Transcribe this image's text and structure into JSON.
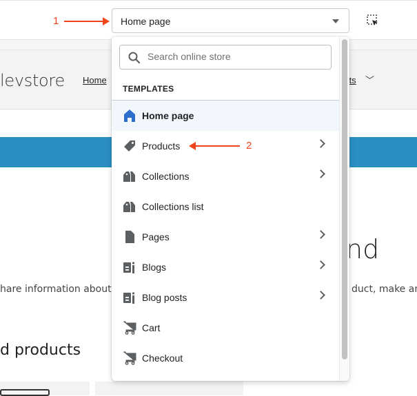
{
  "toolbar": {
    "template_select_value": "Home page",
    "caret_icon": "caret-down-icon",
    "inspect_icon": "select-element-icon"
  },
  "annotations": {
    "one": "1",
    "two": "2",
    "color": "#f0441c"
  },
  "storefront": {
    "store_name": "levstore",
    "nav_home": "Home",
    "nav_products": "cts",
    "banner_color": "#2a8fc1",
    "hero_text": "nd",
    "desc_left": "hare information about",
    "desc_right": "duct, make an",
    "featured": "d products"
  },
  "dropdown": {
    "search_placeholder": "Search online store",
    "section_label": "TEMPLATES",
    "items": [
      {
        "label": "Home page",
        "icon": "home-icon",
        "active": true,
        "chevron": false
      },
      {
        "label": "Products",
        "icon": "tag-icon",
        "chevron": true
      },
      {
        "label": "Collections",
        "icon": "collection-icon",
        "chevron": true
      },
      {
        "label": "Collections list",
        "icon": "collection-icon",
        "chevron": false
      },
      {
        "label": "Pages",
        "icon": "page-icon",
        "chevron": true
      },
      {
        "label": "Blogs",
        "icon": "blog-icon",
        "chevron": true
      },
      {
        "label": "Blog posts",
        "icon": "blog-icon",
        "chevron": true
      },
      {
        "label": "Cart",
        "icon": "cart-icon",
        "chevron": false
      },
      {
        "label": "Checkout",
        "icon": "cart-icon",
        "chevron": false
      }
    ]
  }
}
